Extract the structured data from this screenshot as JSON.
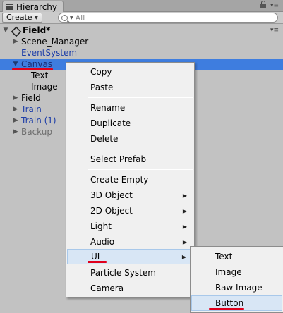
{
  "tab": {
    "title": "Hierarchy"
  },
  "toolbar": {
    "create_label": "Create",
    "search_placeholder": "All"
  },
  "tree": {
    "scene_name": "Field*",
    "items": [
      {
        "label": "Scene_Manager",
        "kind": "normal"
      },
      {
        "label": "EventSystem",
        "kind": "prefab"
      },
      {
        "label": "Canvas",
        "kind": "selected"
      },
      {
        "label": "Text",
        "kind": "normal"
      },
      {
        "label": "Image",
        "kind": "normal"
      },
      {
        "label": "Field",
        "kind": "normal"
      },
      {
        "label": "Train",
        "kind": "prefab"
      },
      {
        "label": "Train (1)",
        "kind": "prefab"
      },
      {
        "label": "Backup",
        "kind": "disabled"
      }
    ]
  },
  "context_menu": {
    "items": [
      "Copy",
      "Paste",
      "Rename",
      "Duplicate",
      "Delete",
      "Select Prefab",
      "Create Empty",
      "3D Object",
      "2D Object",
      "Light",
      "Audio",
      "UI",
      "Particle System",
      "Camera"
    ],
    "highlighted": "UI"
  },
  "submenu": {
    "items": [
      "Text",
      "Image",
      "Raw Image",
      "Button"
    ],
    "highlighted": "Button"
  },
  "colors": {
    "selection": "#3e7ddf",
    "annotation_red": "#e0001b",
    "prefab_text": "#1f3fa8"
  }
}
